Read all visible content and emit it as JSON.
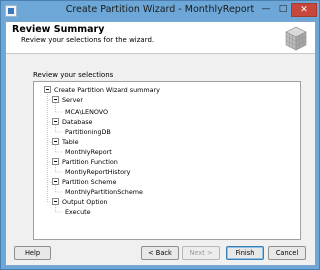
{
  "window": {
    "title": "Create Partition Wizard - MonthlyReport"
  },
  "header": {
    "title": "Review Summary",
    "subtitle": "Review your selections for the wizard."
  },
  "section_label": "Review your selections",
  "tree": {
    "root": "Create Partition Wizard summary",
    "groups": [
      {
        "label": "Server",
        "value": "MCA\\LENOVO"
      },
      {
        "label": "Database",
        "value": "PartitioningDB"
      },
      {
        "label": "Table",
        "value": "MonthlyReport"
      },
      {
        "label": "Partition Function",
        "value": "MontlyReportHistory"
      },
      {
        "label": "Partition Scheme",
        "value": "MonthlyPartitionScheme"
      },
      {
        "label": "Output Option",
        "value": "Execute"
      }
    ]
  },
  "buttons": {
    "help": "Help",
    "back": "< Back",
    "next": "Next >",
    "finish": "Finish",
    "cancel": "Cancel"
  },
  "colors": {
    "title_bar": "#6ca7d8",
    "close_button": "#c7473c"
  },
  "icons": [
    "app-icon",
    "wizard-header-icon",
    "minimize-icon",
    "maximize-icon",
    "close-icon"
  ]
}
